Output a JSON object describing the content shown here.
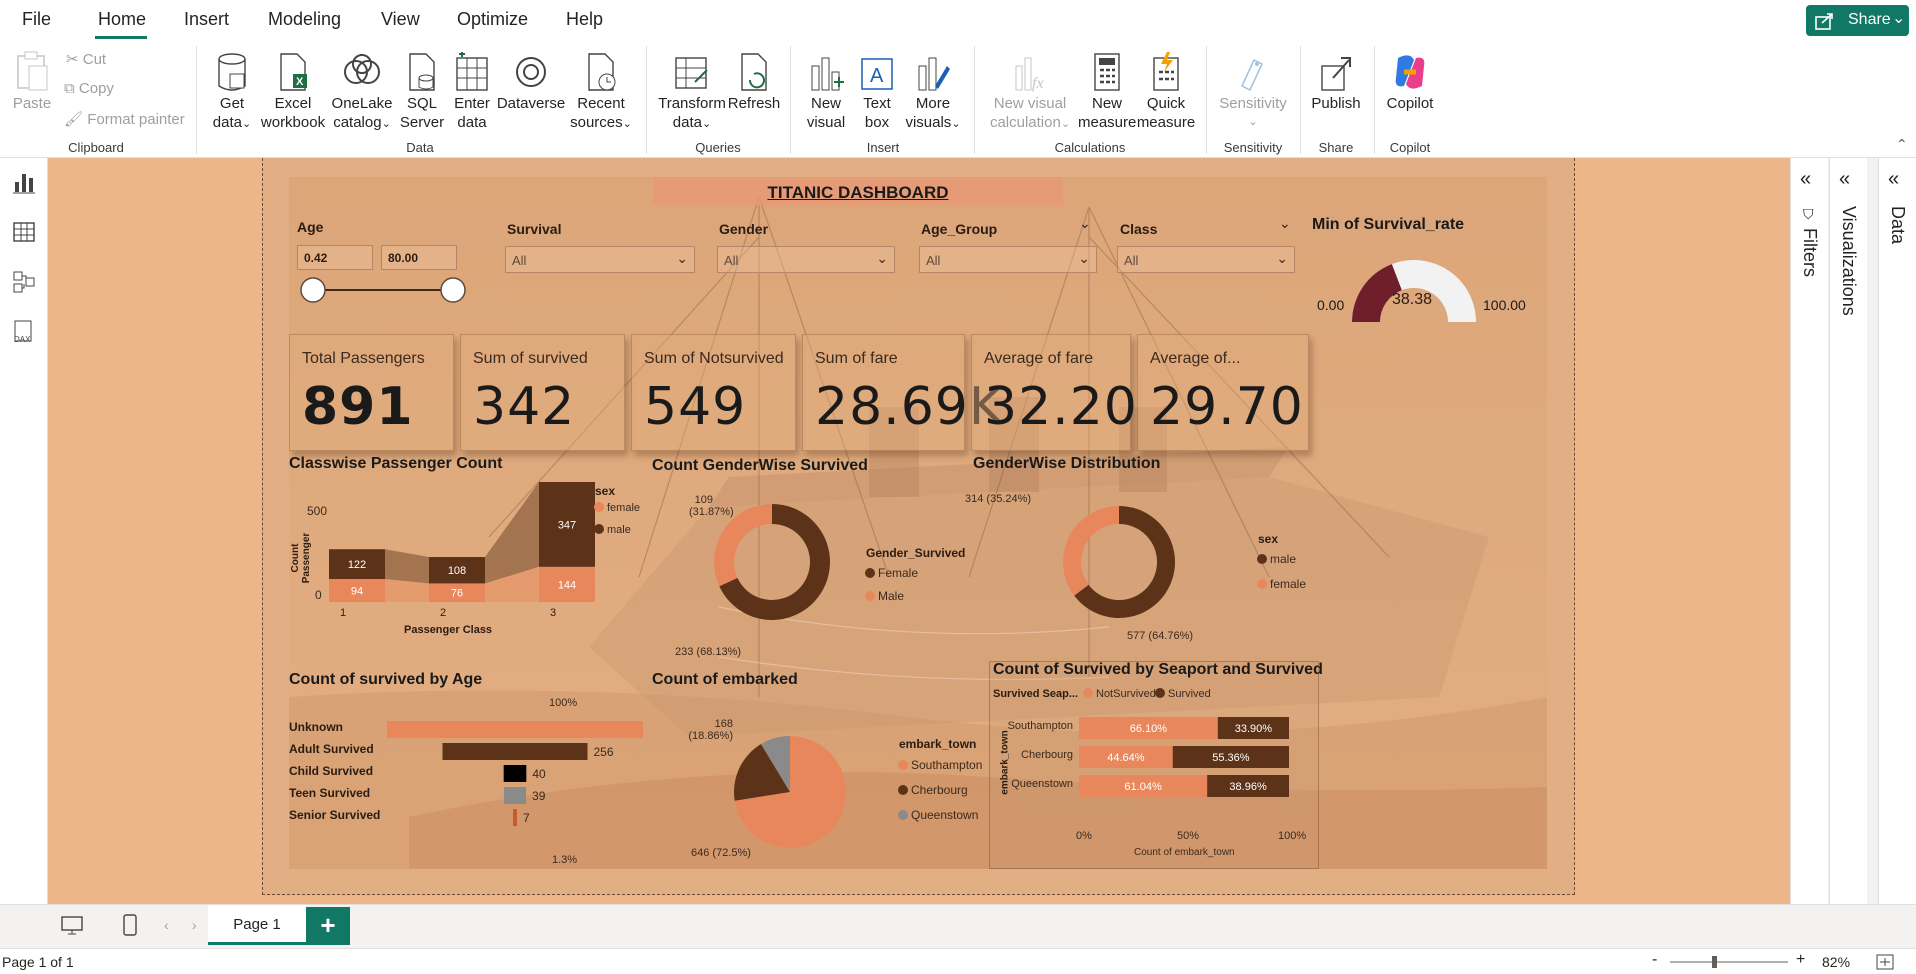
{
  "menu": {
    "tabs": [
      "File",
      "Home",
      "Insert",
      "Modeling",
      "View",
      "Optimize",
      "Help"
    ],
    "share_label": "Share"
  },
  "ribbon": {
    "clipboard": {
      "paste": "Paste",
      "cut": "Cut",
      "copy": "Copy",
      "format_painter": "Format painter",
      "group": "Clipboard"
    },
    "data": {
      "get_data": [
        "Get",
        "data"
      ],
      "excel": [
        "Excel",
        "workbook"
      ],
      "onelake": [
        "OneLake",
        "catalog"
      ],
      "sql": [
        "SQL",
        "Server"
      ],
      "enter": [
        "Enter",
        "data"
      ],
      "dataverse": [
        "Dataverse",
        ""
      ],
      "recent": [
        "Recent",
        "sources"
      ],
      "group": "Data"
    },
    "queries": {
      "transform": [
        "Transform",
        "data"
      ],
      "refresh": [
        "Refresh",
        ""
      ],
      "group": "Queries"
    },
    "insert": {
      "new_visual": [
        "New",
        "visual"
      ],
      "text_box": [
        "Text",
        "box"
      ],
      "more_visuals": [
        "More",
        "visuals"
      ],
      "group": "Insert"
    },
    "calculations": {
      "new_visual_calc": [
        "New visual",
        "calculation"
      ],
      "new_measure": [
        "New",
        "measure"
      ],
      "quick_measure": [
        "Quick",
        "measure"
      ],
      "group": "Calculations"
    },
    "sensitivity": {
      "label": "Sensitivity",
      "group": "Sensitivity"
    },
    "share": {
      "publish": "Publish",
      "group": "Share"
    },
    "copilot": {
      "label": "Copilot",
      "group": "Copilot"
    }
  },
  "panes": {
    "filters": "Filters",
    "visualizations": "Visualizations",
    "data": "Data"
  },
  "pages": {
    "current": "Page 1",
    "status": "Page 1 of 1",
    "zoom": "82%"
  },
  "dashboard": {
    "title": "TITANIC DASHBOARD",
    "slicers": {
      "age_label": "Age",
      "age_min": "0.42",
      "age_max": "80.00",
      "survival_label": "Survival",
      "survival_value": "All",
      "gender_label": "Gender",
      "gender_value": "All",
      "age_group_label": "Age_Group",
      "age_group_value": "All",
      "class_label": "Class",
      "class_value": "All"
    },
    "gauge": {
      "title": "Min of Survival_rate",
      "value": 38.38,
      "value_text": "38.38",
      "min_text": "0.00",
      "max_text": "100.00",
      "min": 0,
      "max": 100
    },
    "cards": [
      {
        "label": "Total Passengers",
        "value": "891"
      },
      {
        "label": "Sum of survived",
        "value": "342"
      },
      {
        "label": "Sum of Notsurvived",
        "value": "549"
      },
      {
        "label": "Sum of fare",
        "value": "28.69K"
      },
      {
        "label": "Average of fare",
        "value": "32.20"
      },
      {
        "label": "Average of...",
        "value": "29.70"
      }
    ],
    "colors": {
      "male": "#5c3318",
      "female": "#e9875c",
      "grey": "#8a8a8a",
      "black": "#000000",
      "senior": "#c9592e"
    }
  },
  "chart_data": [
    {
      "type": "bar",
      "title": "Classwise Passenger Count",
      "xlabel": "Passenger Class",
      "ylabel": "Count Passenger",
      "categories": [
        "1",
        "2",
        "3"
      ],
      "legend_title": "sex",
      "series": [
        {
          "name": "female",
          "values": [
            94,
            76,
            144
          ]
        },
        {
          "name": "male",
          "values": [
            122,
            108,
            347
          ]
        }
      ],
      "yticks": [
        "0",
        "500"
      ],
      "ylim": [
        0,
        500
      ]
    },
    {
      "type": "pie",
      "title": "Count GenderWise Survived",
      "legend_title": "Gender_Survived",
      "slices": [
        {
          "name": "Female",
          "value": 233,
          "label": "233 (68.13%)"
        },
        {
          "name": "Male",
          "value": 109,
          "label": "109 (31.87%)"
        }
      ]
    },
    {
      "type": "pie",
      "title": "GenderWise Distribution",
      "legend_title": "sex",
      "slices": [
        {
          "name": "male",
          "value": 577,
          "label": "577 (64.76%)"
        },
        {
          "name": "female",
          "value": 314,
          "label": "314 (35.24%)"
        }
      ]
    },
    {
      "type": "bar",
      "title": "Count of survived by Age",
      "categories": [
        "Unknown",
        "Adult Survived",
        "Child Survived",
        "Teen Survived",
        "Senior Survived"
      ],
      "values": [
        null,
        256,
        40,
        39,
        7
      ],
      "value_labels": [
        "",
        "256",
        "40",
        "39",
        "7"
      ],
      "top_label": "100%",
      "bottom_label": "1.3%"
    },
    {
      "type": "pie",
      "title": "Count of embarked",
      "legend_title": "embark_town",
      "slices": [
        {
          "name": "Southampton",
          "value": 646,
          "label": "646 (72.5%)"
        },
        {
          "name": "Cherbourg",
          "value": 168,
          "label": "168 (18.86%)"
        },
        {
          "name": "Queenstown",
          "value": 77,
          "label": ""
        }
      ]
    },
    {
      "type": "bar",
      "title": "Count of Survived by Seaport and Survived",
      "xlabel": "Count of embark_town",
      "ylabel": "embark_town",
      "legend_title": "Survived Seap...",
      "categories": [
        "Southampton",
        "Cherbourg",
        "Queenstown"
      ],
      "series": [
        {
          "name": "NotSurvived",
          "values": [
            66.1,
            44.64,
            61.04
          ],
          "labels": [
            "66.10%",
            "44.64%",
            "61.04%"
          ]
        },
        {
          "name": "Survived",
          "values": [
            33.9,
            55.36,
            38.96
          ],
          "labels": [
            "33.90%",
            "55.36%",
            "38.96%"
          ]
        }
      ],
      "xticks": [
        "0%",
        "50%",
        "100%"
      ]
    }
  ]
}
